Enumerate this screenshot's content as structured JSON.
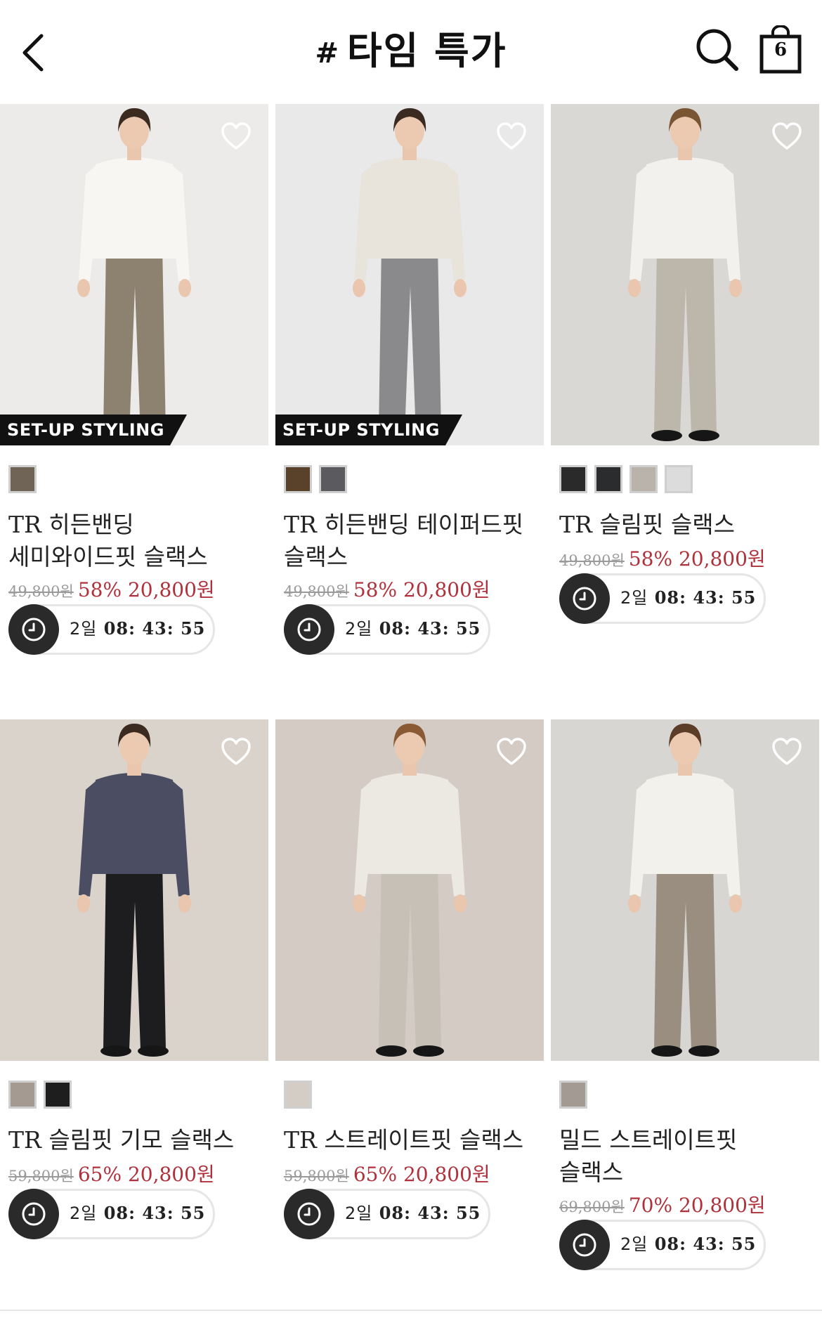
{
  "header": {
    "back_icon": "chevron-left-icon",
    "hash": "#",
    "title": "타임 특가",
    "search_icon": "search-icon",
    "bag_icon": "shopping-bag-icon",
    "bag_count": "6"
  },
  "products": [
    {
      "badge": "SET-UP STYLING",
      "swatches": [
        "#6f6455"
      ],
      "name_prefix": "TR",
      "name_line1": " 히든밴딩",
      "name_line2": "세미와이드핏 슬랙스",
      "original_price": "49,800원",
      "discount": "58%",
      "sale_price": "20,800원",
      "timer_day": "2일",
      "timer_time": "08: 43: 55",
      "palette": {
        "bg": "#ecebe9",
        "top": "#f7f6f3",
        "bottom": "#8d8170",
        "hair": "#3a2a1f"
      }
    },
    {
      "badge": "SET-UP STYLING",
      "swatches": [
        "#5a412a",
        "#5b5b5f"
      ],
      "name_prefix": "TR",
      "name_line1": " 히든밴딩 테이퍼드핏",
      "name_line2": "슬랙스",
      "original_price": "49,800원",
      "discount": "58%",
      "sale_price": "20,800원",
      "timer_day": "2일",
      "timer_time": "08: 43: 55",
      "palette": {
        "bg": "#e9e9ea",
        "top": "#e8e4dc",
        "bottom": "#8a8a8c",
        "hair": "#3a2a1f"
      }
    },
    {
      "badge": "",
      "swatches": [
        "#2a2a2a",
        "#2b2c2e",
        "#b9b3ab",
        "#dcdcdc"
      ],
      "name_prefix": "TR",
      "name_line1": " 슬림핏 슬랙스",
      "name_line2": "",
      "original_price": "49,800원",
      "discount": "58%",
      "sale_price": "20,800원",
      "timer_day": "2일",
      "timer_time": "08: 43: 55",
      "palette": {
        "bg": "#dad8d5",
        "top": "#f2f1ee",
        "bottom": "#bdb6ab",
        "hair": "#7a5534"
      }
    },
    {
      "badge": "",
      "swatches": [
        "#a49a91",
        "#1e1e1e"
      ],
      "name_prefix": "TR",
      "name_line1": " 슬림핏 기모 슬랙스",
      "name_line2": "",
      "original_price": "59,800원",
      "discount": "65%",
      "sale_price": "20,800원",
      "timer_day": "2일",
      "timer_time": "08: 43: 55",
      "palette": {
        "bg": "#d9d3cc",
        "top": "#4b4d63",
        "bottom": "#1d1d1f",
        "hair": "#3b2a20"
      }
    },
    {
      "badge": "",
      "swatches": [
        "#d3cdc5"
      ],
      "name_prefix": "TR",
      "name_line1": " 스트레이트핏 슬랙스",
      "name_line2": "",
      "original_price": "59,800원",
      "discount": "65%",
      "sale_price": "20,800원",
      "timer_day": "2일",
      "timer_time": "08: 43: 55",
      "palette": {
        "bg": "#d3cbc4",
        "top": "#ece8e2",
        "bottom": "#c7c0b6",
        "hair": "#8a5a35"
      }
    },
    {
      "badge": "",
      "swatches": [
        "#a39a93"
      ],
      "name_prefix": "",
      "name_line1": "밀드 스트레이트핏",
      "name_line2": "슬랙스",
      "original_price": "69,800원",
      "discount": "70%",
      "sale_price": "20,800원",
      "timer_day": "2일",
      "timer_time": "08: 43: 55",
      "palette": {
        "bg": "#d8d6d3",
        "top": "#f3f1ec",
        "bottom": "#9a8e80",
        "hair": "#5b3d28"
      }
    }
  ]
}
